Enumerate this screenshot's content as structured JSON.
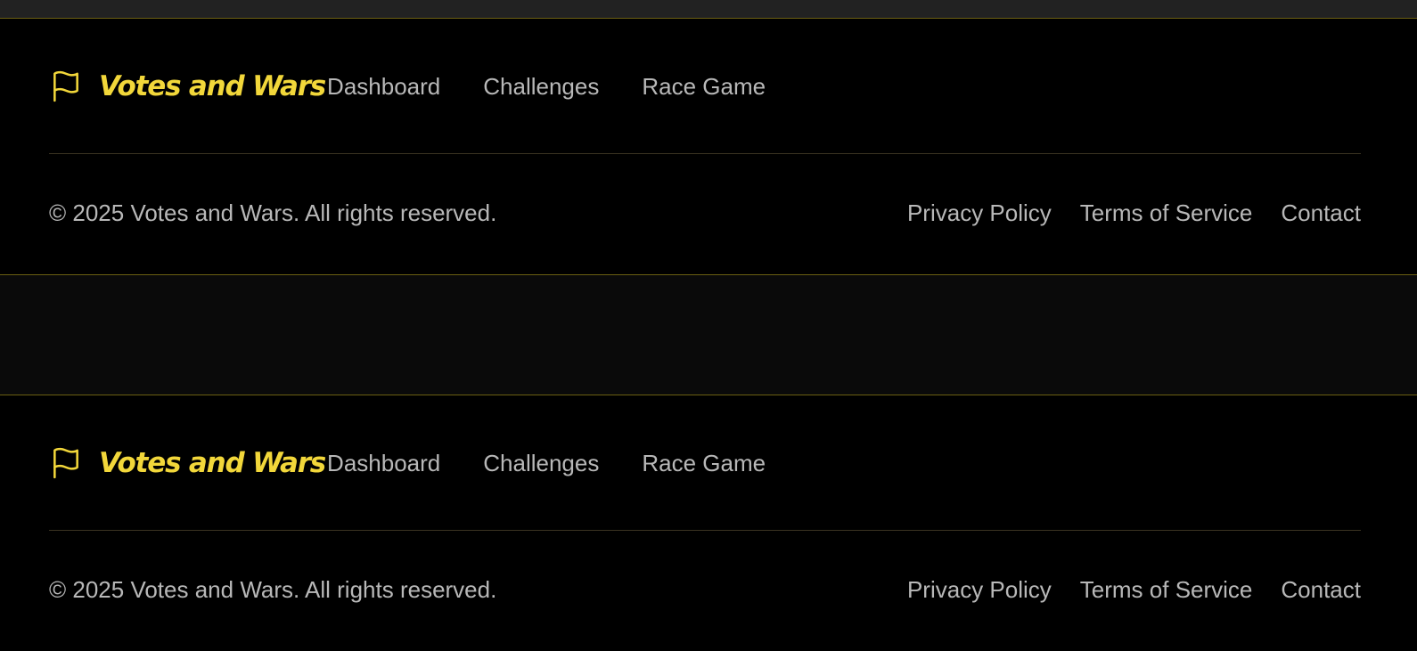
{
  "colors": {
    "accent": "#f2d73a",
    "border_accent": "#6b5f12",
    "text_muted": "#b8b8b8",
    "background": "#000000"
  },
  "footers": [
    {
      "brand": {
        "icon": "flag-icon",
        "name": "Votes and Wars"
      },
      "nav": [
        "Dashboard",
        "Challenges",
        "Race Game"
      ],
      "copyright": "© 2025 Votes and Wars. All rights reserved.",
      "legal_links": [
        "Privacy Policy",
        "Terms of Service",
        "Contact"
      ]
    },
    {
      "brand": {
        "icon": "flag-icon",
        "name": "Votes and Wars"
      },
      "nav": [
        "Dashboard",
        "Challenges",
        "Race Game"
      ],
      "copyright": "© 2025 Votes and Wars. All rights reserved.",
      "legal_links": [
        "Privacy Policy",
        "Terms of Service",
        "Contact"
      ]
    }
  ]
}
